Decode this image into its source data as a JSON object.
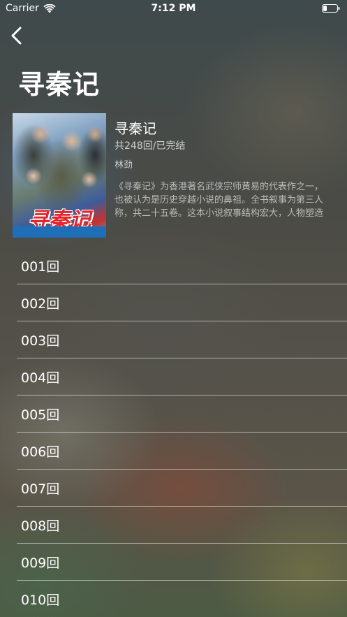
{
  "status_bar": {
    "carrier": "Carrier",
    "time": "7:12 PM"
  },
  "nav": {
    "back_icon": "chevron-left-icon"
  },
  "page": {
    "title": "寻秦记"
  },
  "show": {
    "cover_logo_text": "寻秦记",
    "title": "寻秦记",
    "count": "共248回/已完结",
    "author": "林劲",
    "description": "《寻秦记》为香港著名武侠宗师黄易的代表作之一，也被认为是历史穿越小说的鼻祖。全书叙事为第三人称，共二十五卷。这本小说叙事结构宏大，人物塑造丰满而深具魅力；并且剧情跌宕起伏，扣人心弦。"
  },
  "episodes": [
    {
      "label": "001回"
    },
    {
      "label": "002回"
    },
    {
      "label": "003回"
    },
    {
      "label": "004回"
    },
    {
      "label": "005回"
    },
    {
      "label": "006回"
    },
    {
      "label": "007回"
    },
    {
      "label": "008回"
    },
    {
      "label": "009回"
    },
    {
      "label": "010回"
    }
  ],
  "colors": {
    "text": "#ffffff",
    "secondary_text": "#b8b8b4",
    "separator": "#c8c8c4"
  }
}
